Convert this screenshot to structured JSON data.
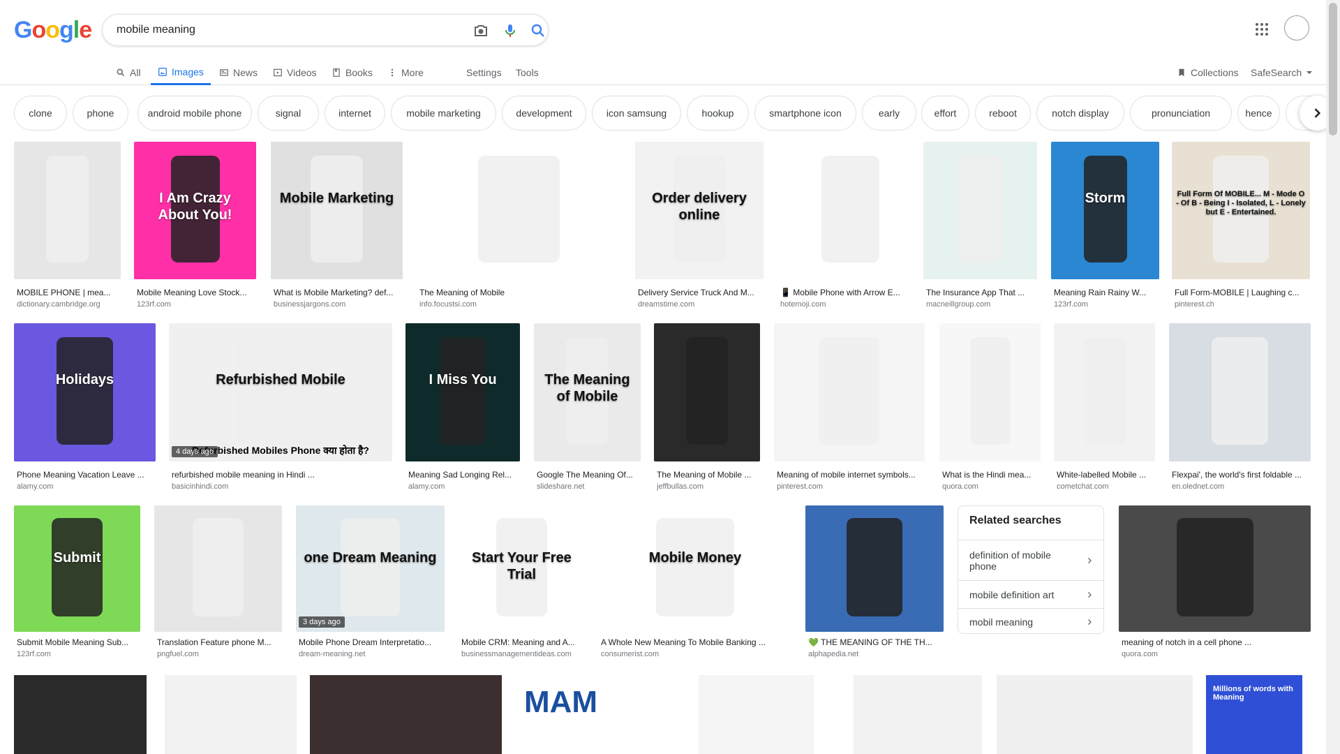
{
  "logo": {
    "letters": [
      "G",
      "o",
      "o",
      "g",
      "l",
      "e"
    ],
    "colors": [
      "#4285F4",
      "#EA4335",
      "#FBBC05",
      "#4285F4",
      "#34A853",
      "#EA4335"
    ]
  },
  "search": {
    "query": "mobile meaning"
  },
  "icons": {
    "camera": "camera-icon",
    "mic": "mic-icon",
    "search": "search-icon",
    "apps": "apps-grid-icon",
    "account": "account-avatar-icon"
  },
  "tabs": {
    "all": "All",
    "images": "Images",
    "news": "News",
    "videos": "Videos",
    "books": "Books",
    "more": "More",
    "settings": "Settings",
    "tools": "Tools"
  },
  "right_tools": {
    "collections": "Collections",
    "safesearch": "SafeSearch"
  },
  "chips": [
    "clone",
    "phone",
    "android mobile phone",
    "signal",
    "internet",
    "mobile marketing",
    "development",
    "icon samsung",
    "hookup",
    "smartphone icon",
    "early",
    "effort",
    "reboot",
    "notch display",
    "pronunciation",
    "hence",
    "e"
  ],
  "accent_color": "#1a73e8",
  "row1": [
    {
      "caption": "MOBILE PHONE | mea...",
      "source": "dictionary.cambridge.org",
      "img_text": ""
    },
    {
      "caption": "Mobile Meaning Love Stock...",
      "source": "123rf.com",
      "img_text": "I Am Crazy About You!"
    },
    {
      "caption": "What is Mobile Marketing? def...",
      "source": "businessjargons.com",
      "img_text": "Mobile Marketing"
    },
    {
      "caption": "The Meaning of Mobile",
      "source": "info.focustsi.com",
      "img_text": ""
    },
    {
      "caption": "Delivery Service Truck And M...",
      "source": "dreamstime.com",
      "img_text": "Order delivery online"
    },
    {
      "caption": "📱 Mobile Phone with Arrow E...",
      "source": "hotemoji.com",
      "img_text": ""
    },
    {
      "caption": "The Insurance App That ...",
      "source": "macneillgroup.com",
      "img_text": ""
    },
    {
      "caption": "Meaning Rain Rainy W...",
      "source": "123rf.com",
      "img_text": "Storm"
    },
    {
      "caption": "Full Form-MOBILE | Laughing c...",
      "source": "pinterest.ch",
      "img_text": "Full Form Of MOBILE... M - Mode O - Of B - Being I - Isolated, L - Lonely but E - Entertained."
    }
  ],
  "row2": [
    {
      "caption": "Phone Meaning Vacation Leave ...",
      "source": "alamy.com",
      "img_text": "Holidays",
      "badge": ""
    },
    {
      "caption": "refurbished mobile meaning in Hindi ...",
      "source": "basicinhindi.com",
      "img_text": "Refurbished Mobile",
      "sub_text": "Refurbished Mobiles Phone क्या होता है?",
      "badge": "4 days ago"
    },
    {
      "caption": "Meaning Sad Longing Rel...",
      "source": "alamy.com",
      "img_text": "I Miss You",
      "badge": ""
    },
    {
      "caption": "Google The Meaning Of...",
      "source": "slideshare.net",
      "img_text": "The Meaning of Mobile",
      "badge": ""
    },
    {
      "caption": "The Meaning of Mobile ...",
      "source": "jeffbullas.com",
      "img_text": "",
      "badge": ""
    },
    {
      "caption": "Meaning of mobile internet symbols...",
      "source": "pinterest.com",
      "img_text": "",
      "badge": ""
    },
    {
      "caption": "What is the Hindi mea...",
      "source": "quora.com",
      "img_text": "",
      "badge": ""
    },
    {
      "caption": "White-labelled Mobile ...",
      "source": "cometchat.com",
      "img_text": "",
      "badge": ""
    },
    {
      "caption": "Flexpai', the world's first foldable ...",
      "source": "en.olednet.com",
      "img_text": "",
      "badge": ""
    }
  ],
  "row3": [
    {
      "caption": "Submit Mobile Meaning Sub...",
      "source": "123rf.com",
      "img_text": "Submit",
      "badge": ""
    },
    {
      "caption": "Translation Feature phone M...",
      "source": "pngfuel.com",
      "img_text": "",
      "badge": ""
    },
    {
      "caption": "Mobile Phone Dream Interpretatio...",
      "source": "dream-meaning.net",
      "img_text": "one Dream Meaning",
      "badge": "3 days ago"
    },
    {
      "caption": "Mobile CRM: Meaning and A...",
      "source": "businessmanagementideas.com",
      "img_text": "Start Your Free Trial",
      "badge": ""
    },
    {
      "caption": "A Whole New Meaning To Mobile Banking ...",
      "source": "consumerist.com",
      "img_text": "Mobile Money",
      "badge": ""
    },
    {
      "caption": "💚 THE MEANING OF THE TH...",
      "source": "alphapedia.net",
      "img_text": "",
      "badge": ""
    },
    {
      "caption": "meaning of notch in a cell phone ...",
      "source": "quora.com",
      "img_text": "",
      "badge": ""
    }
  ],
  "row4_texts": [
    "",
    "",
    "",
    "MAM",
    "",
    "",
    "",
    "Millions of words with Meaning"
  ],
  "related": {
    "title": "Related searches",
    "items": [
      "definition of mobile phone",
      "mobile definition art",
      "mobil meaning"
    ]
  }
}
